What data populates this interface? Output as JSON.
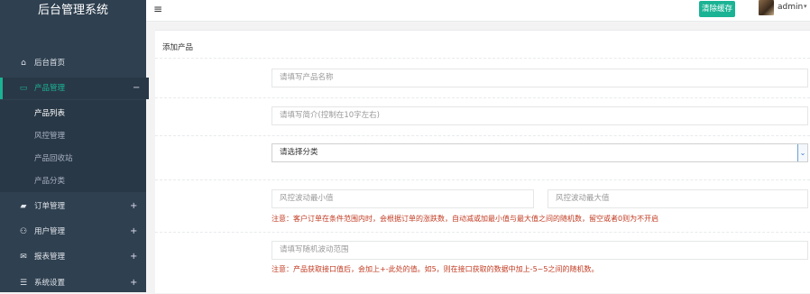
{
  "app": {
    "title": "后台管理系统"
  },
  "sidebar": {
    "items": [
      {
        "icon": "home-icon",
        "glyph": "⌂",
        "label": "后台首页",
        "expand": ""
      },
      {
        "icon": "monitor-icon",
        "glyph": "▭",
        "label": "产品管理",
        "expand": "−"
      },
      {
        "icon": "book-icon",
        "glyph": "▰",
        "label": "订单管理",
        "expand": "+"
      },
      {
        "icon": "users-icon",
        "glyph": "⚇",
        "label": "用户管理",
        "expand": "+"
      },
      {
        "icon": "envelope-icon",
        "glyph": "✉",
        "label": "报表管理",
        "expand": "+"
      },
      {
        "icon": "settings-icon",
        "glyph": "☰",
        "label": "系统设置",
        "expand": "+"
      }
    ],
    "sub_items": [
      "产品列表",
      "风控管理",
      "产品回收站",
      "产品分类"
    ]
  },
  "topbar": {
    "menu_glyph": "≡",
    "clear_cache_label": "清除缓存",
    "user_name": "admin",
    "caret": "▾"
  },
  "form": {
    "title": "添加产品",
    "name_placeholder": "请填写产品名称",
    "intro_placeholder": "请填写简介(控制在10字左右)",
    "category_selected": "请选择分类",
    "select_arrow": "⌄",
    "risk_min_placeholder": "风控波动最小值",
    "risk_max_placeholder": "风控波动最大值",
    "risk_note": "注意：客户订单在条件范围内时，会根据订单的涨跌数，自动减或加最小值与最大值之间的随机数，留空或者0则为不开启",
    "random_placeholder": "请填写随机波动范围",
    "random_note": "注意：产品获取接口值后，会加上+-此处的值。如5，则在接口获取的数据中加上-5~5之间的随机数。"
  },
  "colors": {
    "sidebar_bg": "#2f4050",
    "accent": "#1ab394",
    "warning_text": "#c23b22"
  }
}
